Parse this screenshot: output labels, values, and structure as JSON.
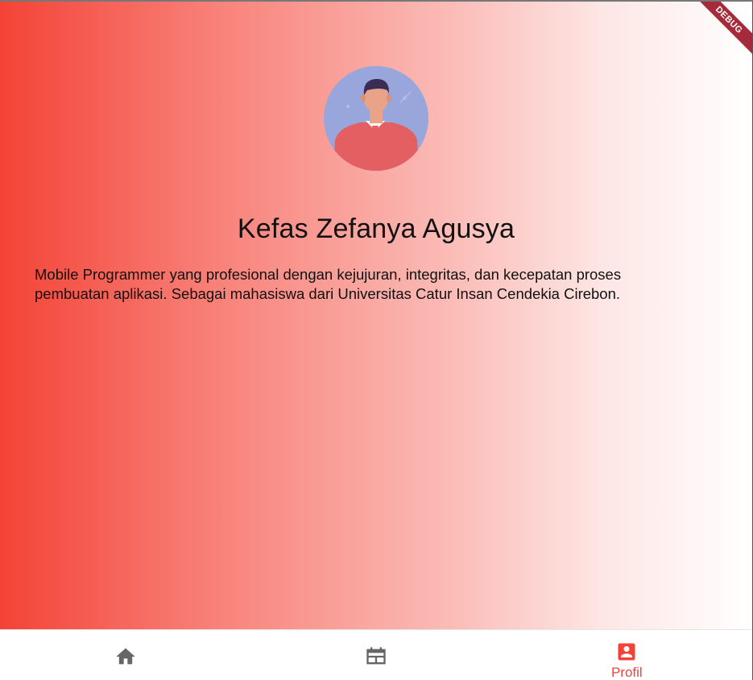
{
  "profile": {
    "name": "Kefas Zefanya Agusya",
    "bio": "Mobile Programmer yang profesional dengan kejujuran, integritas, dan kecepatan proses pembuatan aplikasi. Sebagai mahasiswa dari Universitas Catur Insan Cendekia Cirebon."
  },
  "debug_banner": "DEBUG",
  "bottom_nav": {
    "items": [
      {
        "icon": "home-icon",
        "label": ""
      },
      {
        "icon": "calendar-view-icon",
        "label": ""
      },
      {
        "icon": "account-box-icon",
        "label": "Profil",
        "active": true
      }
    ]
  },
  "colors": {
    "accent": "#f44336",
    "gradient_start": "#f44336",
    "gradient_end": "#ffffff",
    "inactive_icon": "#666666"
  }
}
